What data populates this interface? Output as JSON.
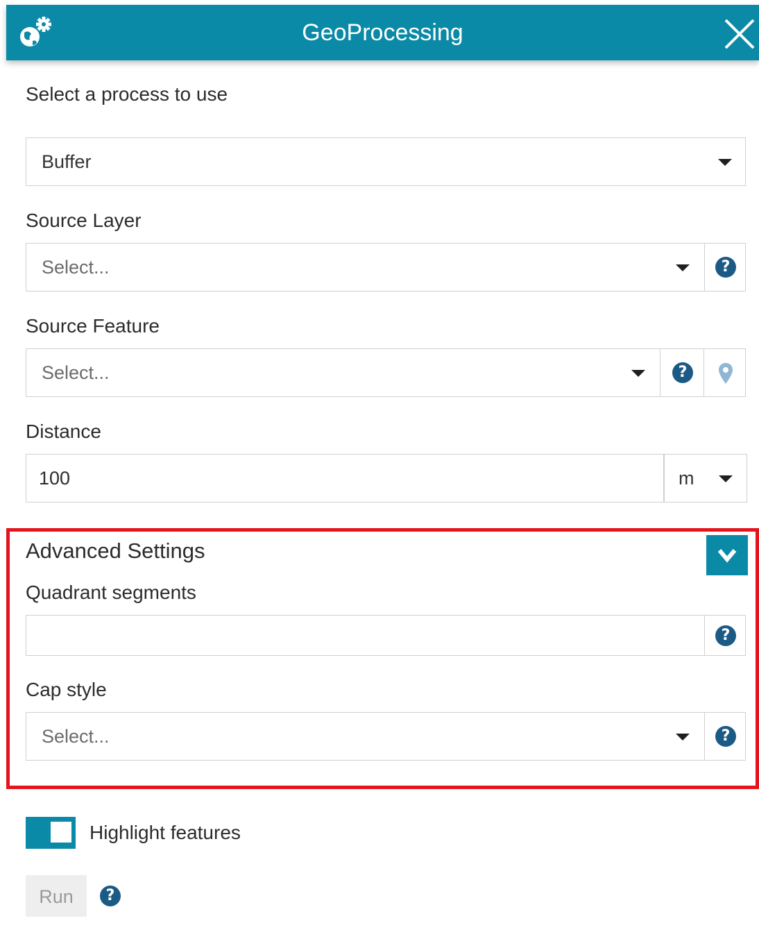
{
  "header": {
    "title": "GeoProcessing"
  },
  "process": {
    "label": "Select a process to use",
    "value": "Buffer"
  },
  "source_layer": {
    "label": "Source Layer",
    "placeholder": "Select..."
  },
  "source_feature": {
    "label": "Source Feature",
    "placeholder": "Select..."
  },
  "distance": {
    "label": "Distance",
    "value": "100",
    "unit": "m"
  },
  "advanced": {
    "title": "Advanced Settings",
    "quadrant_label": "Quadrant segments",
    "quadrant_value": "",
    "cap_label": "Cap style",
    "cap_placeholder": "Select..."
  },
  "highlight": {
    "label": "Highlight features",
    "enabled": true
  },
  "run": {
    "label": "Run"
  },
  "colors": {
    "accent": "#0a8aa6",
    "help": "#1c5a86",
    "highlight_border": "#e3141b"
  }
}
